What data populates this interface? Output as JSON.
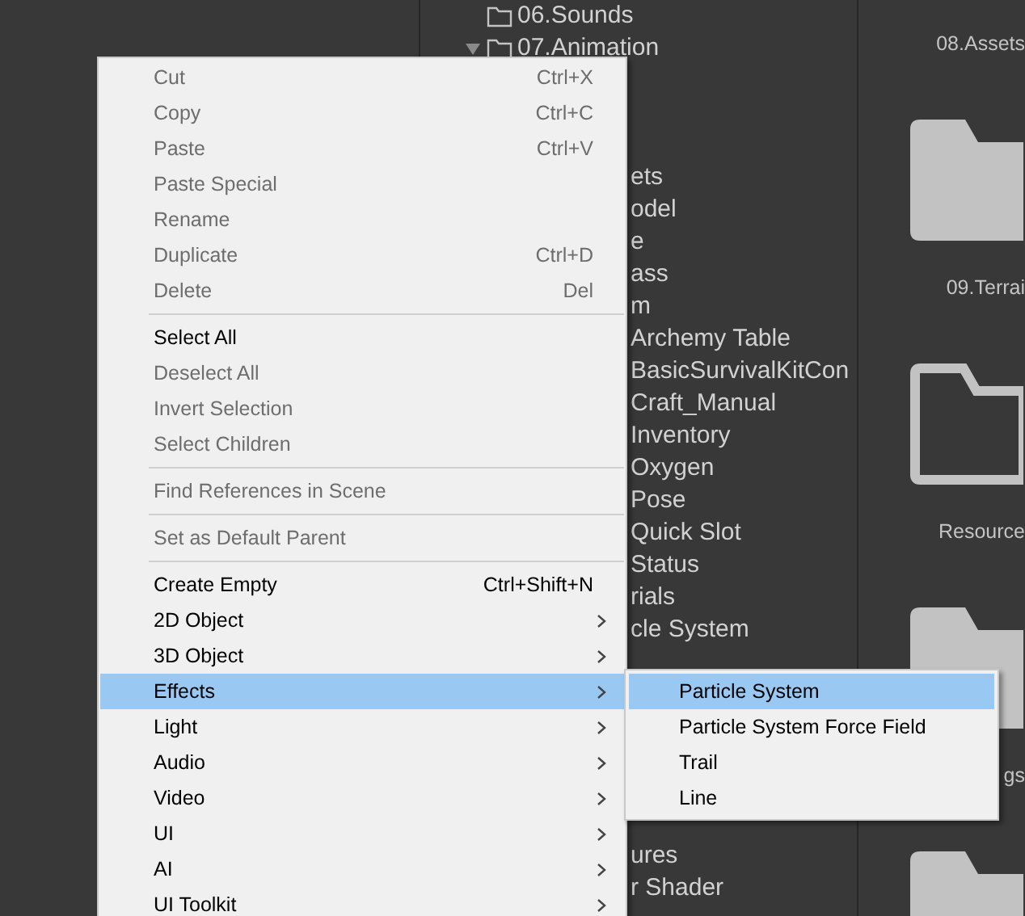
{
  "tree": [
    {
      "label": "06.Sounds"
    },
    {
      "label": "07.Animation",
      "expanded": true,
      "children": [
        "ets",
        "odel",
        "e",
        "ass",
        "m",
        "Archemy Table",
        "BasicSurvivalKitCon",
        "Craft_Manual",
        "Inventory",
        "Oxygen",
        "Pose",
        "Quick Slot",
        "Status",
        "rials",
        "cle System"
      ]
    }
  ],
  "tree_lower": [
    "ures",
    "r Shader"
  ],
  "assets": [
    {
      "label": "08.Assets"
    },
    {
      "kind": "filled",
      "label": "09.Terrai"
    },
    {
      "kind": "outline",
      "label": "Resource"
    },
    {
      "kind": "filled",
      "label": "gs"
    },
    {
      "kind": "filled"
    }
  ],
  "menu": {
    "sections": [
      {
        "items": [
          {
            "label": "Cut",
            "shortcut": "Ctrl+X",
            "disabled": true
          },
          {
            "label": "Copy",
            "shortcut": "Ctrl+C",
            "disabled": true
          },
          {
            "label": "Paste",
            "shortcut": "Ctrl+V",
            "disabled": true
          },
          {
            "label": "Paste Special",
            "disabled": true
          },
          {
            "label": "Rename",
            "disabled": true
          },
          {
            "label": "Duplicate",
            "shortcut": "Ctrl+D",
            "disabled": true
          },
          {
            "label": "Delete",
            "shortcut": "Del",
            "disabled": true
          }
        ]
      },
      {
        "items": [
          {
            "label": "Select All",
            "disabled": false
          },
          {
            "label": "Deselect All",
            "disabled": true
          },
          {
            "label": "Invert Selection",
            "disabled": true
          },
          {
            "label": "Select Children",
            "disabled": true
          }
        ]
      },
      {
        "items": [
          {
            "label": "Find References in Scene",
            "disabled": true
          }
        ]
      },
      {
        "items": [
          {
            "label": "Set as Default Parent",
            "disabled": true
          }
        ]
      },
      {
        "items": [
          {
            "label": "Create Empty",
            "shortcut": "Ctrl+Shift+N",
            "disabled": false
          },
          {
            "label": "2D Object",
            "disabled": false,
            "submenu_arrow": true
          },
          {
            "label": "3D Object",
            "disabled": false,
            "submenu_arrow": true
          },
          {
            "label": "Effects",
            "disabled": false,
            "submenu_arrow": true,
            "selected": true,
            "submenu": [
              {
                "label": "Particle System",
                "selected": true
              },
              {
                "label": "Particle System Force Field",
                "selected": false
              },
              {
                "label": "Trail",
                "selected": false
              },
              {
                "label": "Line",
                "selected": false
              }
            ]
          },
          {
            "label": "Light",
            "disabled": false,
            "submenu_arrow": true
          },
          {
            "label": "Audio",
            "disabled": false,
            "submenu_arrow": true
          },
          {
            "label": "Video",
            "disabled": false,
            "submenu_arrow": true
          },
          {
            "label": "UI",
            "disabled": false,
            "submenu_arrow": true
          },
          {
            "label": "AI",
            "disabled": false,
            "submenu_arrow": true
          },
          {
            "label": "UI Toolkit",
            "disabled": false,
            "submenu_arrow": true
          }
        ]
      }
    ]
  }
}
